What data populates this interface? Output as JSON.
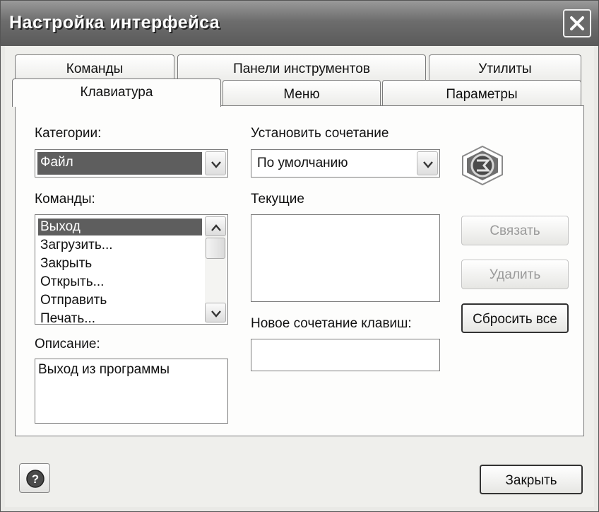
{
  "window": {
    "title": "Настройка интерфейса"
  },
  "tabs": {
    "commands": "Команды",
    "toolbars": "Панели инструментов",
    "utilities": "Утилиты",
    "keyboard": "Клавиатура",
    "menu": "Меню",
    "parameters": "Параметры",
    "active": "Клавиатура"
  },
  "keyboard": {
    "categories_label": "Категории:",
    "categories_value": "Файл",
    "commands_label": "Команды:",
    "commands": [
      "Выход",
      "Загрузить...",
      "Закрыть",
      "Открыть...",
      "Отправить",
      "Печать..."
    ],
    "selected_command": "Выход",
    "description_label": "Описание:",
    "description": "Выход из программы",
    "set_combo_label": "Установить сочетание",
    "set_combo_value": "По умолчанию",
    "current_label": "Текущие",
    "new_combo_label": "Новое сочетание клавиш:",
    "new_combo_value": "",
    "bind_button": "Связать",
    "delete_button": "Удалить",
    "reset_all_button": "Сбросить все"
  },
  "footer": {
    "close_button": "Закрыть"
  },
  "icons": {
    "close": "close-icon",
    "dropdown": "chevron-down-icon",
    "scroll_up": "chevron-up-icon",
    "scroll_down": "chevron-down-icon",
    "help": "help-icon",
    "logo": "app-logo-icon"
  }
}
